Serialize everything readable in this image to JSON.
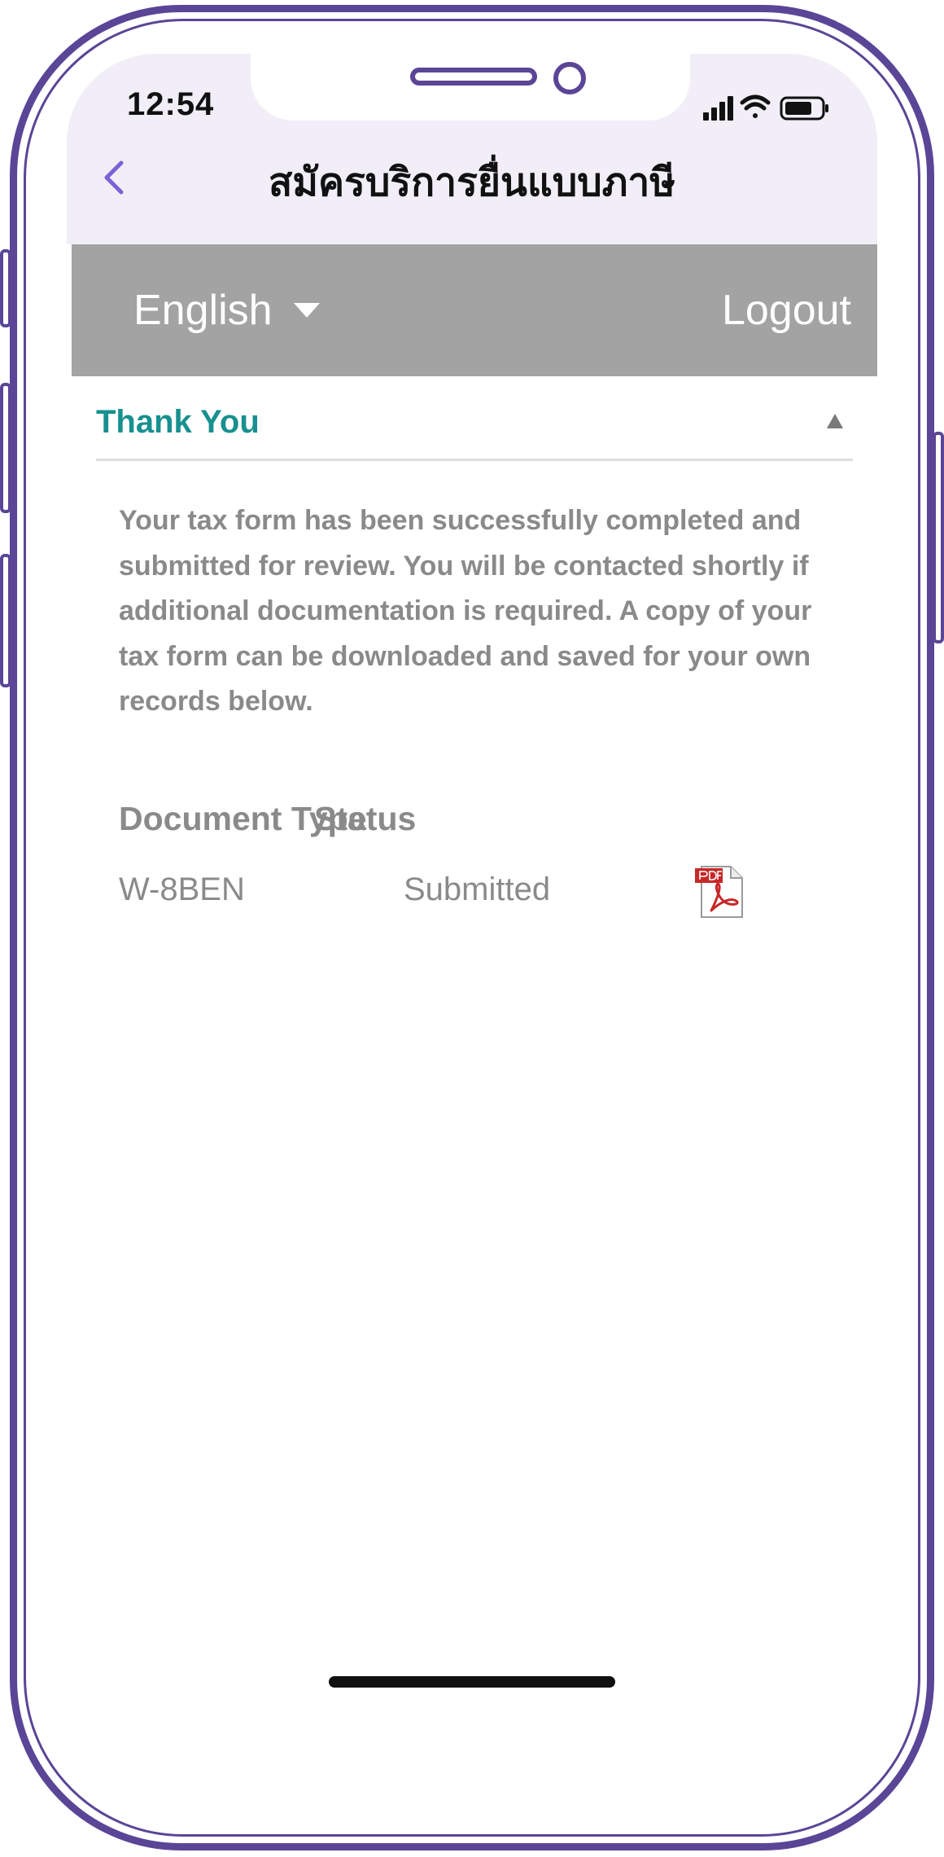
{
  "status_bar": {
    "time": "12:54"
  },
  "nav": {
    "title": "สมัครบริการยื่นแบบภาษี",
    "back_icon": "chevron-left-icon"
  },
  "toolbar": {
    "language": "English",
    "logout_label": "Logout"
  },
  "section": {
    "title": "Thank You",
    "message": "Your tax form has been successfully completed and submitted for review. You will be contacted shortly if additional documentation is required. A copy of your tax form can be downloaded and saved for your own records below."
  },
  "documents": {
    "headers": {
      "type": "Document Type",
      "status": "Status"
    },
    "rows": [
      {
        "type": "W-8BEN",
        "status": "Submitted",
        "icon": "pdf-icon"
      }
    ]
  },
  "colors": {
    "frame": "#5a4596",
    "header_bg": "#f1eef7",
    "lang_bar_bg": "#a3a3a3",
    "accent_teal": "#17908f",
    "text_gray": "#8a8a8a",
    "back_purple": "#7b61d6"
  }
}
